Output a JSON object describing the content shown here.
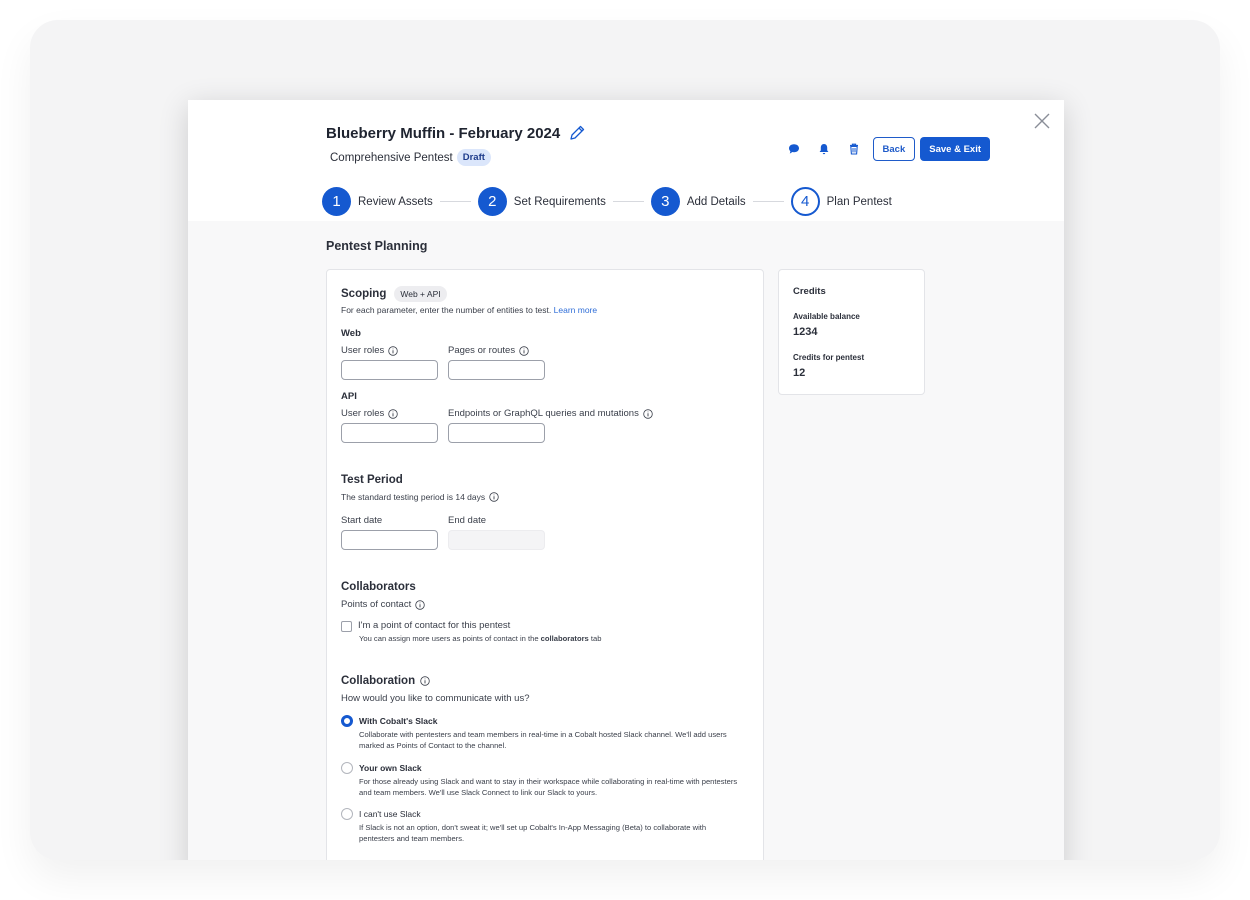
{
  "header": {
    "title": "Blueberry Muffin - February 2024",
    "subtitle": "Comprehensive Pentest",
    "status_badge": "Draft",
    "back_label": "Back",
    "save_label": "Save & Exit"
  },
  "steps": [
    {
      "number": "1",
      "label": "Review Assets"
    },
    {
      "number": "2",
      "label": "Set Requirements"
    },
    {
      "number": "3",
      "label": "Add Details"
    },
    {
      "number": "4",
      "label": "Plan Pentest"
    }
  ],
  "page_heading": "Pentest Planning",
  "scoping": {
    "title": "Scoping",
    "tag": "Web + API",
    "description": "For each parameter, enter the number of entities to test.",
    "learn_more": "Learn more",
    "web": {
      "heading": "Web",
      "user_roles": "User roles",
      "pages": "Pages or routes"
    },
    "api": {
      "heading": "API",
      "user_roles": "User roles",
      "endpoints": "Endpoints or GraphQL queries and mutations"
    }
  },
  "test_period": {
    "title": "Test Period",
    "description": "The standard testing period is 14 days",
    "start_label": "Start date",
    "end_label": "End date"
  },
  "collaborators": {
    "title": "Collaborators",
    "points_label": "Points of contact",
    "checkbox_label": "I'm a point of contact for this pentest",
    "hint_prefix": "You can assign more users as points of contact in the",
    "hint_bold": "collaborators",
    "hint_suffix": "tab"
  },
  "collaboration": {
    "title": "Collaboration",
    "question": "How would you like to communicate with us?",
    "options": [
      {
        "title": "With Cobalt's Slack",
        "desc": "Collaborate with pentesters and team members in real-time in a Cobalt hosted Slack channel. We'll add users marked as Points of Contact to the channel.",
        "selected": true
      },
      {
        "title": "Your own Slack",
        "desc": "For those already using Slack and want to stay in their workspace while collaborating in real-time with pentesters and team members. We'll use Slack Connect to link our Slack to yours.",
        "selected": false
      },
      {
        "title": "I can't use Slack",
        "desc": "If Slack is not an option, don't sweat it; we'll set up Cobalt's In-App Messaging (Beta) to collaborate with pentesters and team members.",
        "selected": false
      }
    ]
  },
  "credits": {
    "title": "Credits",
    "balance_label": "Available balance",
    "balance_value": "1234",
    "pentest_label": "Credits for pentest",
    "pentest_value": "12"
  },
  "icons": {
    "close": "close-icon",
    "edit": "pencil-icon",
    "chat": "chat-icon",
    "bell": "bell-icon",
    "trash": "trash-icon",
    "info": "info-icon"
  },
  "colors": {
    "primary": "#1559d0",
    "badge_bg": "#dbe6fb",
    "link": "#2f6ed8"
  }
}
